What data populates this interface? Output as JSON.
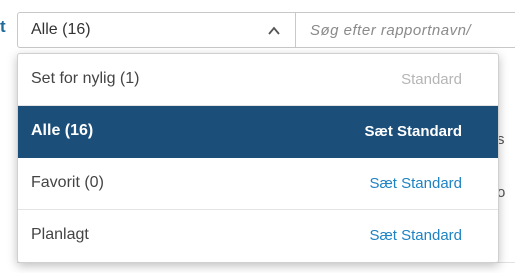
{
  "header": {
    "left_fragment": "t",
    "filter_select": {
      "value": "Alle (16)"
    },
    "search": {
      "placeholder": "Søg efter rapportnavn/"
    }
  },
  "dropdown": {
    "options": [
      {
        "label": "Set for nylig (1)",
        "action": "Standard",
        "state": "default-muted"
      },
      {
        "label": "Alle (16)",
        "action": "Sæt Standard",
        "state": "selected"
      },
      {
        "label": "Favorit (0)",
        "action": "Sæt Standard",
        "state": "normal"
      },
      {
        "label": "Planlagt",
        "action": "Sæt Standard",
        "state": "normal"
      }
    ]
  },
  "background": {
    "fragment_1": "s",
    "fragment_2": "o"
  },
  "colors": {
    "accent": "#1e83c3",
    "selected_bg": "#1c4e7a",
    "muted": "#b5b5b5"
  },
  "icons": {
    "select_toggle": "chevron-up-icon"
  }
}
